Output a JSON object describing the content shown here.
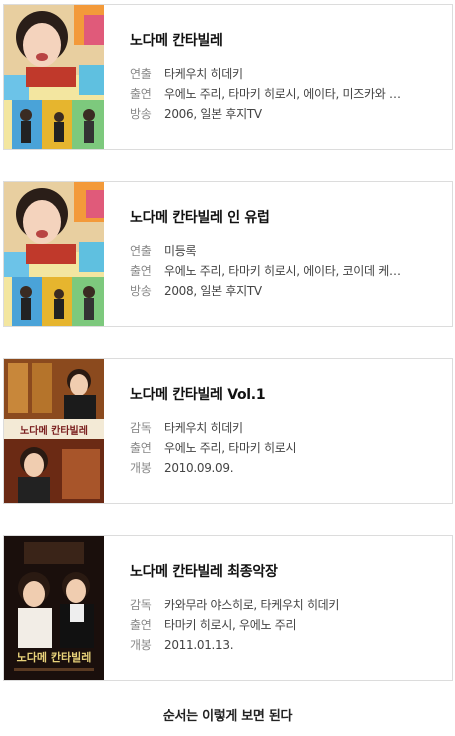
{
  "cards": [
    {
      "title": "노다메 칸타빌레",
      "rows": [
        {
          "k": "연출",
          "v": "타케우치 히데키"
        },
        {
          "k": "출연",
          "v": "우에노 주리, 타마키 히로시, 에이타, 미즈카와 …"
        },
        {
          "k": "방송",
          "v": "2006, 일본 후지TV"
        }
      ]
    },
    {
      "title": "노다메 칸타빌레 인 유럽",
      "rows": [
        {
          "k": "연출",
          "v": "미등록"
        },
        {
          "k": "출연",
          "v": "우에노 주리, 타마키 히로시, 에이타, 코이데 케…"
        },
        {
          "k": "방송",
          "v": "2008, 일본 후지TV"
        }
      ]
    },
    {
      "title": "노다메 칸타빌레 Vol.1",
      "rows": [
        {
          "k": "감독",
          "v": "타케우치 히데키"
        },
        {
          "k": "출연",
          "v": "우에노 주리, 타마키 히로시"
        },
        {
          "k": "개봉",
          "v": "2010.09.09."
        }
      ]
    },
    {
      "title": "노다메 칸타빌레 최종악장",
      "rows": [
        {
          "k": "감독",
          "v": "카와무라 야스히로, 타케우치 히데키"
        },
        {
          "k": "출연",
          "v": "타마키 히로시, 우에노 주리"
        },
        {
          "k": "개봉",
          "v": "2011.01.13."
        }
      ]
    }
  ],
  "poster_text": {
    "p3_logo": "노다메 칸타빌레",
    "p4_logo": "노다메 칸타빌레"
  },
  "footer": "순서는 이렇게 보면 된다"
}
